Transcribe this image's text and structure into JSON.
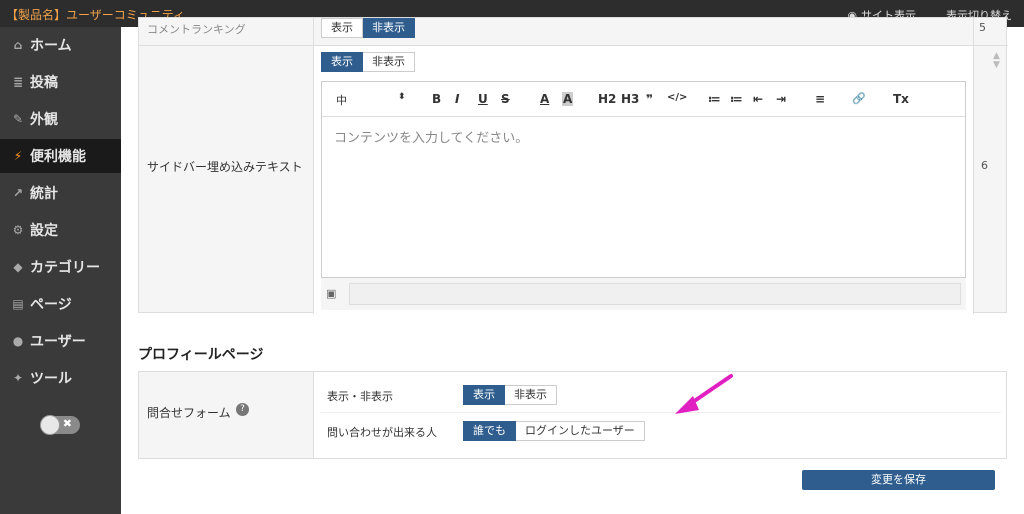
{
  "topbar": {
    "title": "【製品名】ユーザーコミュニティ...",
    "site_view": "サイト表示",
    "switch_view": "表示切り替え"
  },
  "sidebar": {
    "items": [
      {
        "label": "ホーム",
        "icon": "home-icon",
        "glyph": "⌂"
      },
      {
        "label": "投稿",
        "icon": "list-icon",
        "glyph": "≣"
      },
      {
        "label": "外観",
        "icon": "brush-icon",
        "glyph": "✎"
      },
      {
        "label": "便利機能",
        "icon": "plug-icon",
        "glyph": "⚡"
      },
      {
        "label": "統計",
        "icon": "chart-icon",
        "glyph": "↗"
      },
      {
        "label": "設定",
        "icon": "gears-icon",
        "glyph": "⚙"
      },
      {
        "label": "カテゴリー",
        "icon": "tag-icon",
        "glyph": "◆"
      },
      {
        "label": "ページ",
        "icon": "file-icon",
        "glyph": "▤"
      },
      {
        "label": "ユーザー",
        "icon": "users-icon",
        "glyph": "●"
      },
      {
        "label": "ツール",
        "icon": "wrench-icon",
        "glyph": "✦"
      }
    ],
    "active_index": 3
  },
  "top_row": {
    "label": "コメントランキング",
    "show": "表示",
    "hide": "非表示",
    "order": "5"
  },
  "sidebar_embed": {
    "label": "サイドバー埋め込みテキスト",
    "show": "表示",
    "hide": "非表示",
    "order": "6",
    "editor": {
      "size_select": "中",
      "toolbar": [
        "B",
        "I",
        "U",
        "S",
        "A",
        "A",
        "H2",
        "H3",
        "❞",
        "</>",
        "≔",
        "≔",
        "⇤",
        "⇥",
        "≡",
        "🔗",
        "Tx"
      ],
      "placeholder": "コンテンツを入力してください。"
    }
  },
  "profile_section": {
    "title": "プロフィールページ",
    "row_label": "問合せフォーム",
    "visibility_label": "表示・非表示",
    "visibility_show": "表示",
    "visibility_hide": "非表示",
    "who_label": "問い合わせが出来る人",
    "who_anyone": "誰でも",
    "who_logged_in": "ログインしたユーザー"
  },
  "save_button": "変更を保存",
  "colors": {
    "accent": "#2e5d8e",
    "arrow": "#e020c0",
    "title_orange": "#f0a24a"
  }
}
